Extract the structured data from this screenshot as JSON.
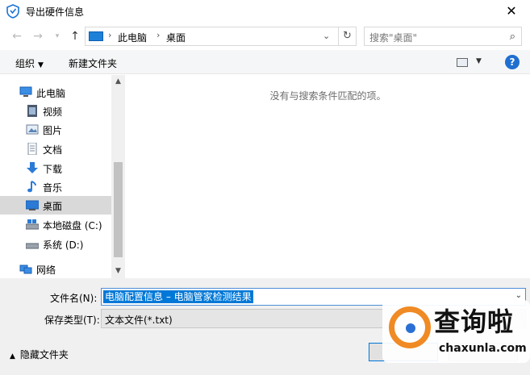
{
  "window": {
    "title": "导出硬件信息"
  },
  "address_bar": {
    "crumbs": [
      "此电脑",
      "桌面"
    ]
  },
  "search": {
    "placeholder": "搜索\"桌面\""
  },
  "toolbar": {
    "organize_label": "组织",
    "new_folder_label": "新建文件夹"
  },
  "nav_pane": {
    "items": [
      {
        "label": "此电脑",
        "icon": "pc-icon"
      },
      {
        "label": "视频",
        "icon": "video-icon"
      },
      {
        "label": "图片",
        "icon": "pictures-icon"
      },
      {
        "label": "文档",
        "icon": "documents-icon"
      },
      {
        "label": "下载",
        "icon": "download-icon"
      },
      {
        "label": "音乐",
        "icon": "music-icon"
      },
      {
        "label": "桌面",
        "icon": "desktop-icon",
        "selected": true
      },
      {
        "label": "本地磁盘 (C:)",
        "icon": "drive-icon"
      },
      {
        "label": "系统 (D:)",
        "icon": "drive-icon"
      },
      {
        "label": "网络",
        "icon": "network-icon"
      }
    ]
  },
  "content": {
    "empty_message": "没有与搜索条件匹配的项。"
  },
  "form": {
    "filename_label": "文件名(N):",
    "filename_value": "电脑配置信息 – 电脑管家检测结果",
    "type_label": "保存类型(T):",
    "type_value": "文本文件(*.txt)"
  },
  "footer": {
    "hide_folders_label": "隐藏文件夹"
  },
  "watermark": {
    "text": "查询啦",
    "url": "chaxunla.com"
  },
  "colors": {
    "accent": "#0078d7",
    "selected_bg": "#d9d9d9",
    "toolbar_bg": "#f5f6f7",
    "bottom_bg": "#f0f0f0"
  }
}
